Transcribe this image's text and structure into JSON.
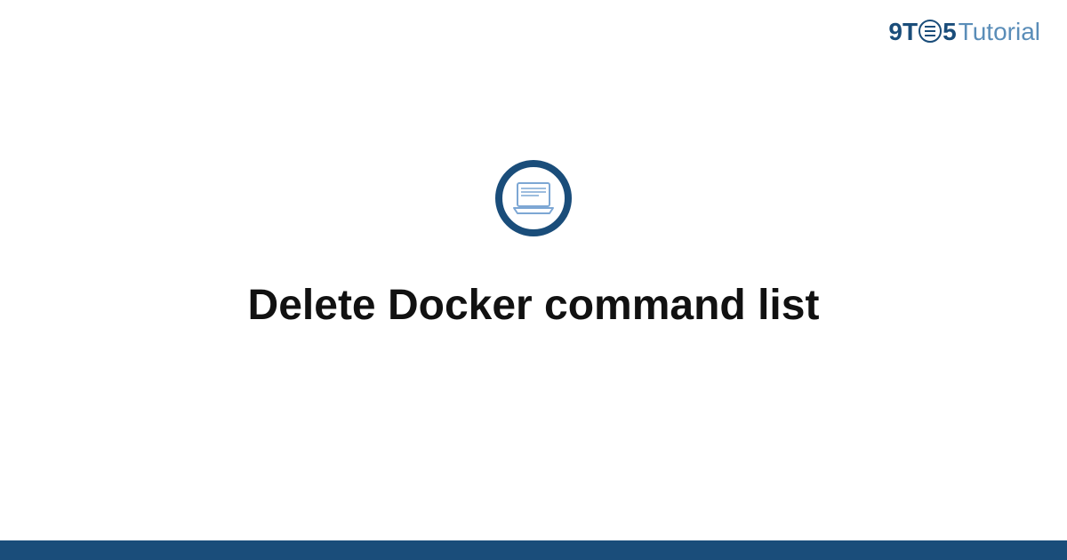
{
  "logo": {
    "part1": "9T",
    "part2": "5",
    "part3": "Tutorial"
  },
  "title": "Delete Docker command list",
  "colors": {
    "brandDark": "#1a4d7a",
    "brandLight": "#5a8db8",
    "iconOutline": "#7da7d4"
  }
}
